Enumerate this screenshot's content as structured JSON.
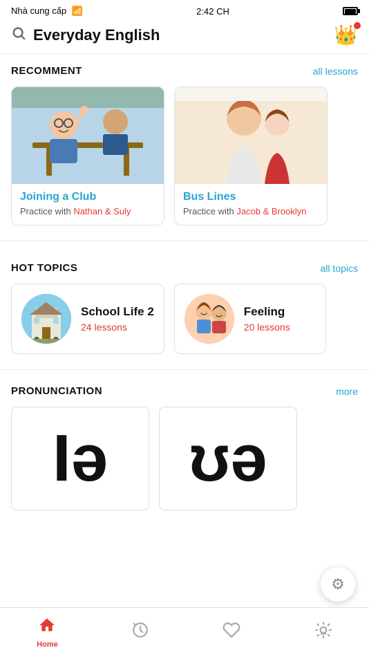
{
  "statusBar": {
    "carrier": "Nhà cung cấp",
    "time": "2:42 CH"
  },
  "header": {
    "title": "Everyday English",
    "searchAriaLabel": "search"
  },
  "recomment": {
    "sectionTitle": "RECOMMENT",
    "linkLabel": "all lessons",
    "lessons": [
      {
        "id": "joining-club",
        "title": "Joining a Club",
        "sub": "Practice with ",
        "partners": "Nathan & Suly",
        "imageType": "joining"
      },
      {
        "id": "bus-lines",
        "title": "Bus Lines",
        "sub": "Practice with ",
        "partners": "Jacob & Brooklyn",
        "imageType": "bus"
      }
    ]
  },
  "hotTopics": {
    "sectionTitle": "HOT TOPICS",
    "linkLabel": "all topics",
    "topics": [
      {
        "id": "school-life-2",
        "name": "School Life 2",
        "lessons": "24 lessons",
        "imageType": "school"
      },
      {
        "id": "feeling",
        "name": "Feeling",
        "lessons": "20 lessons",
        "imageType": "feeling"
      }
    ]
  },
  "pronunciation": {
    "sectionTitle": "PRONUNCIATION",
    "linkLabel": "more",
    "items": [
      {
        "id": "ia",
        "symbol": "Iə"
      },
      {
        "id": "ue",
        "symbol": "ʊə"
      }
    ]
  },
  "fab": {
    "icon": "⚙"
  },
  "bottomNav": {
    "items": [
      {
        "id": "home",
        "icon": "🏠",
        "label": "Home",
        "active": true
      },
      {
        "id": "history",
        "icon": "🕐",
        "label": "",
        "active": false
      },
      {
        "id": "favorites",
        "icon": "♡",
        "label": "",
        "active": false
      },
      {
        "id": "tips",
        "icon": "💡",
        "label": "",
        "active": false
      }
    ]
  }
}
